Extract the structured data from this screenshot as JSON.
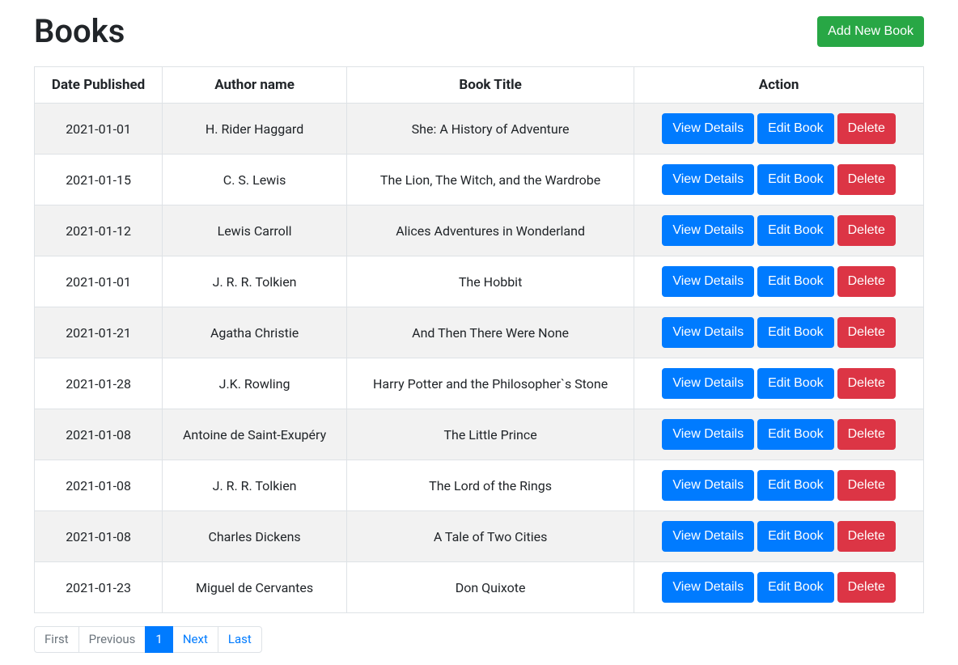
{
  "header": {
    "title": "Books",
    "add_button": "Add New Book"
  },
  "table": {
    "columns": [
      "Date Published",
      "Author name",
      "Book Title",
      "Action"
    ],
    "actions": {
      "view": "View Details",
      "edit": "Edit Book",
      "delete": "Delete"
    },
    "rows": [
      {
        "date": "2021-01-01",
        "author": "H. Rider Haggard",
        "title": "She: A History of Adventure"
      },
      {
        "date": "2021-01-15",
        "author": "C. S. Lewis",
        "title": "The Lion, The Witch, and the Wardrobe"
      },
      {
        "date": "2021-01-12",
        "author": "Lewis Carroll",
        "title": "Alices Adventures in Wonderland"
      },
      {
        "date": "2021-01-01",
        "author": "J. R. R. Tolkien",
        "title": "The Hobbit"
      },
      {
        "date": "2021-01-21",
        "author": "Agatha Christie",
        "title": "And Then There Were None"
      },
      {
        "date": "2021-01-28",
        "author": "J.K. Rowling",
        "title": "Harry Potter and the Philosopher`s Stone"
      },
      {
        "date": "2021-01-08",
        "author": "Antoine de Saint-Exupéry",
        "title": "The Little Prince"
      },
      {
        "date": "2021-01-08",
        "author": "J. R. R. Tolkien",
        "title": "The Lord of the Rings"
      },
      {
        "date": "2021-01-08",
        "author": "Charles Dickens",
        "title": "A Tale of Two Cities"
      },
      {
        "date": "2021-01-23",
        "author": "Miguel de Cervantes",
        "title": "Don Quixote"
      }
    ]
  },
  "pagination": {
    "first": "First",
    "previous": "Previous",
    "page": "1",
    "next": "Next",
    "last": "Last"
  }
}
